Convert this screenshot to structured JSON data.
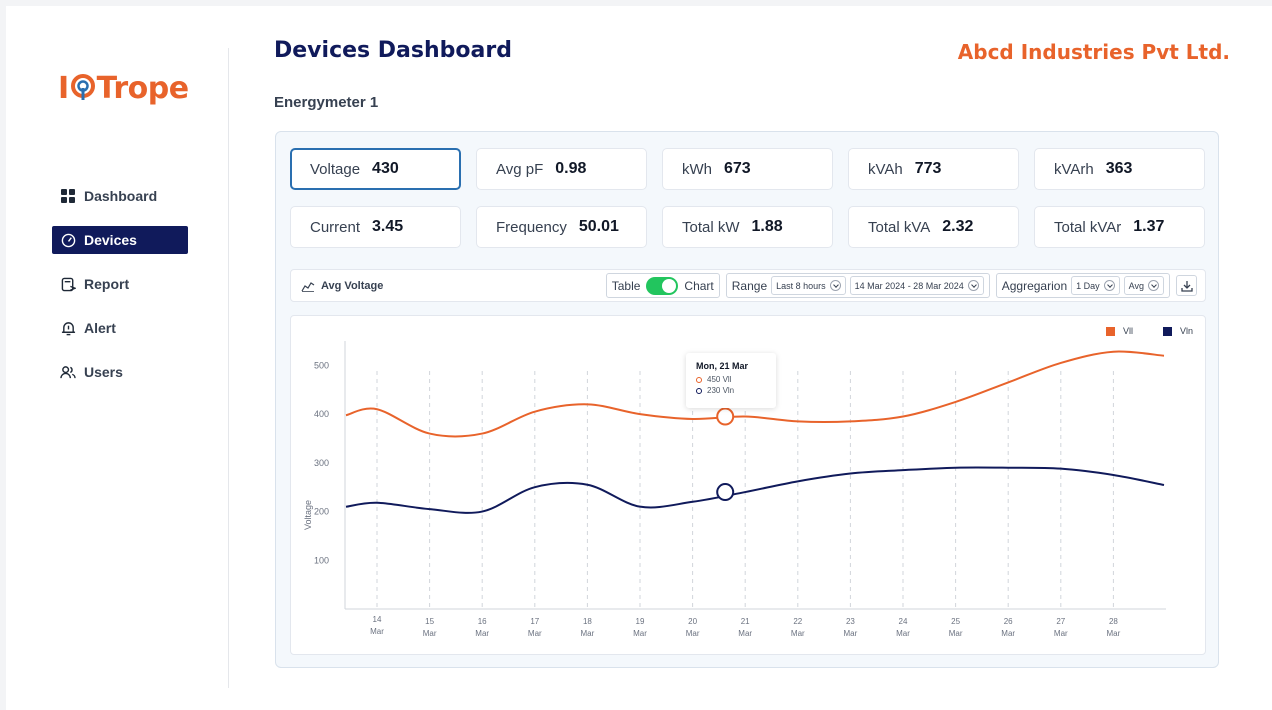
{
  "brand": {
    "logo_prefix": "I",
    "logo_suffix": "Trope"
  },
  "sidebar": {
    "items": [
      {
        "label": "Dashboard",
        "icon": "dashboard-grid-icon",
        "active": false
      },
      {
        "label": "Devices",
        "icon": "gauge-icon",
        "active": true
      },
      {
        "label": "Report",
        "icon": "report-icon",
        "active": false
      },
      {
        "label": "Alert",
        "icon": "bell-alert-icon",
        "active": false
      },
      {
        "label": "Users",
        "icon": "users-icon",
        "active": false
      }
    ]
  },
  "header": {
    "title": "Devices Dashboard",
    "company": "Abcd Industries Pvt Ltd."
  },
  "device": {
    "name": "Energymeter 1"
  },
  "metrics": [
    {
      "label": "Voltage",
      "value": "430",
      "selected": true
    },
    {
      "label": "Avg pF",
      "value": "0.98"
    },
    {
      "label": "kWh",
      "value": "673"
    },
    {
      "label": "kVAh",
      "value": "773"
    },
    {
      "label": "kVArh",
      "value": "363"
    },
    {
      "label": "Current",
      "value": "3.45"
    },
    {
      "label": "Frequency",
      "value": "50.01"
    },
    {
      "label": "Total kW",
      "value": "1.88"
    },
    {
      "label": "Total kVA",
      "value": "2.32"
    },
    {
      "label": "Total kVAr",
      "value": "1.37"
    }
  ],
  "toolbar": {
    "chart_title": "Avg Voltage",
    "toggle_left": "Table",
    "toggle_right": "Chart",
    "range_label": "Range",
    "range_preset": "Last 8 hours",
    "date_range": "14 Mar 2024 - 28 Mar 2024",
    "aggregation_label": "Aggregarion",
    "aggregation_interval": "1 Day",
    "aggregation_fn": "Avg"
  },
  "tooltip": {
    "title": "Mon, 21 Mar",
    "rows": [
      "450 Vll",
      "230 Vln"
    ]
  },
  "colors": {
    "vll": "#e8632b",
    "vln": "#101a5b",
    "accent": "#2a6fb0",
    "toggle_on": "#22c55e"
  },
  "chart_data": {
    "type": "line",
    "ylabel": "Voltage",
    "ylim": [
      0,
      550
    ],
    "yticks": [
      100,
      200,
      300,
      400,
      500
    ],
    "categories": [
      "14 Mar",
      "15 Mar",
      "16 Mar",
      "17 Mar",
      "18 Mar",
      "19 Mar",
      "20 Mar",
      "21 Mar",
      "22 Mar",
      "23 Mar",
      "24 Mar",
      "25 Mar",
      "26 Mar",
      "27 Mar",
      "28 Mar"
    ],
    "series": [
      {
        "name": "Vll",
        "color": "#e8632b",
        "values": [
          410,
          360,
          360,
          405,
          420,
          400,
          390,
          395,
          385,
          385,
          395,
          425,
          465,
          505,
          528
        ]
      },
      {
        "name": "Vln",
        "color": "#101a5b",
        "values": [
          218,
          205,
          200,
          250,
          255,
          210,
          220,
          240,
          262,
          278,
          285,
          290,
          290,
          288,
          275
        ]
      }
    ],
    "legend": "top-right",
    "grid": "vertical-dashed"
  }
}
